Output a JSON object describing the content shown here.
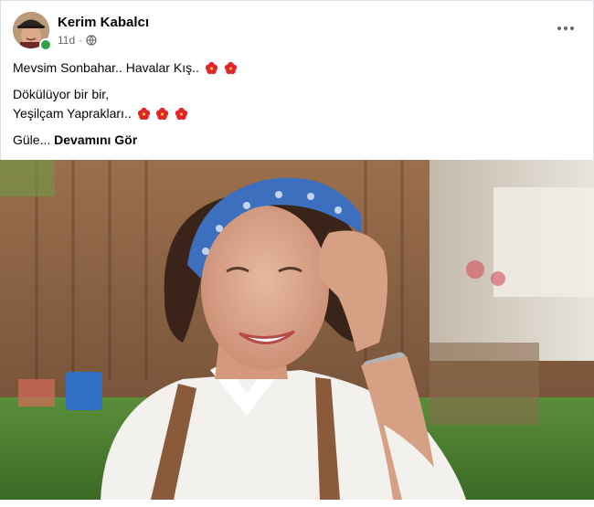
{
  "post": {
    "author": "Kerim Kabalcı",
    "time": "11d",
    "text_line1": "Mevsim Sonbahar.. Havalar Kış..",
    "text_line2": "Dökülüyor bir bir,",
    "text_line3": "Yeşilçam Yaprakları..",
    "text_line4_prefix": "Güle...",
    "see_more": "Devamını Gör"
  },
  "icons": {
    "more": "more-options-icon",
    "privacy": "globe-icon",
    "emoji": "hibiscus-icon"
  },
  "colors": {
    "meta": "#65676b",
    "online": "#31a24c",
    "hibiscus": "#e0242a"
  }
}
